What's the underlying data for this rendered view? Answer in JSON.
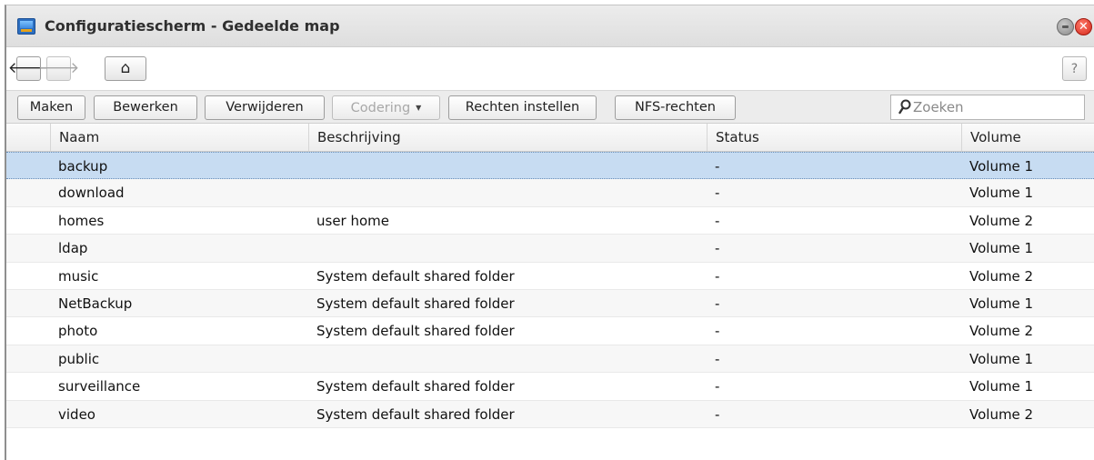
{
  "window": {
    "title": "Configuratiescherm - Gedeelde map",
    "close_glyph": "✕"
  },
  "nav": {
    "back_glyph": "🡐",
    "forward_glyph": "🡒",
    "home_glyph": "⌂",
    "help_glyph": "?"
  },
  "toolbar": {
    "create_label": "Maken",
    "edit_label": "Bewerken",
    "delete_label": "Verwijderen",
    "encryption_label": "Codering",
    "permissions_label": "Rechten instellen",
    "nfs_label": "NFS-rechten",
    "search_placeholder": "Zoeken"
  },
  "table": {
    "columns": [
      "Naam",
      "Beschrijving",
      "Status",
      "Volume"
    ],
    "rows": [
      {
        "name": "backup",
        "description": "",
        "status": "-",
        "volume": "Volume 1"
      },
      {
        "name": "download",
        "description": "",
        "status": "-",
        "volume": "Volume 1"
      },
      {
        "name": "homes",
        "description": "user home",
        "status": "-",
        "volume": "Volume 2"
      },
      {
        "name": "ldap",
        "description": "",
        "status": "-",
        "volume": "Volume 1"
      },
      {
        "name": "music",
        "description": "System default shared folder",
        "status": "-",
        "volume": "Volume 2"
      },
      {
        "name": "NetBackup",
        "description": "System default shared folder",
        "status": "-",
        "volume": "Volume 1"
      },
      {
        "name": "photo",
        "description": "System default shared folder",
        "status": "-",
        "volume": "Volume 2"
      },
      {
        "name": "public",
        "description": "",
        "status": "-",
        "volume": "Volume 1"
      },
      {
        "name": "surveillance",
        "description": "System default shared folder",
        "status": "-",
        "volume": "Volume 1"
      },
      {
        "name": "video",
        "description": "System default shared folder",
        "status": "-",
        "volume": "Volume 2"
      }
    ]
  },
  "icons": {
    "app": "control-panel-icon",
    "minimize": "minimize-icon",
    "close": "close-icon",
    "back": "back-arrow-icon",
    "forward": "forward-arrow-icon",
    "home": "home-icon",
    "help": "help-icon",
    "search": "search-icon",
    "dropdown": "chevron-down-icon"
  },
  "colors": {
    "selected_row": "#c7dcf2",
    "close_button": "#d4281a",
    "toolbar_bg": "#ececec"
  }
}
